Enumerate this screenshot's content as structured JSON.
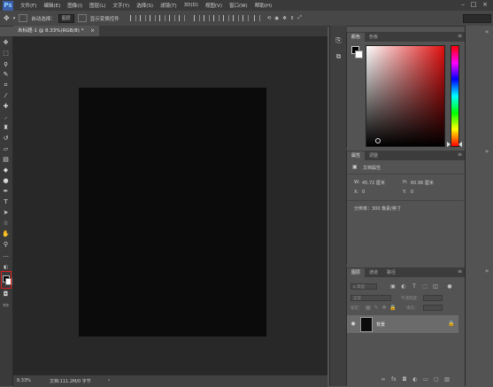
{
  "app": {
    "logo": "Ps"
  },
  "menu": [
    "文件(F)",
    "编辑(E)",
    "图像(I)",
    "图层(L)",
    "文字(Y)",
    "选择(S)",
    "滤镜(T)",
    "3D(D)",
    "视图(V)",
    "窗口(W)",
    "帮助(H)"
  ],
  "options": {
    "auto_select": "自动选择：",
    "auto_select_value": "图层",
    "show_transform": "显示变换控件"
  },
  "document": {
    "tab_title": "未标题-1 @ 8.33%(RGB/8) *",
    "tab_close": "×",
    "zoom": "8.33%",
    "doc_info": "文档:111.2M/0 字节"
  },
  "color_panel": {
    "tabs": [
      "颜色",
      "色板"
    ],
    "colors": {
      "foreground": "#000000",
      "background": "#ffffff"
    }
  },
  "properties_panel": {
    "tabs": [
      "属性",
      "调整"
    ],
    "title": "文档属性",
    "w_label": "W:",
    "w_value": "45.72 厘米",
    "h_label": "H:",
    "h_value": "60.96 厘米",
    "x_label": "X:",
    "x_value": "0",
    "y_label": "Y:",
    "y_value": "0",
    "resolution": "分辨率：300 像素/英寸"
  },
  "layers_panel": {
    "tabs": [
      "图层",
      "通道",
      "路径"
    ],
    "kind_label": "ρ 类型",
    "blend_mode": "正常",
    "opacity_label": "不透明度：",
    "lock_label": "锁定：",
    "fill_label": "填充：",
    "layer_name": "背景"
  },
  "annotation": {
    "arrow_color": "#e02020"
  }
}
